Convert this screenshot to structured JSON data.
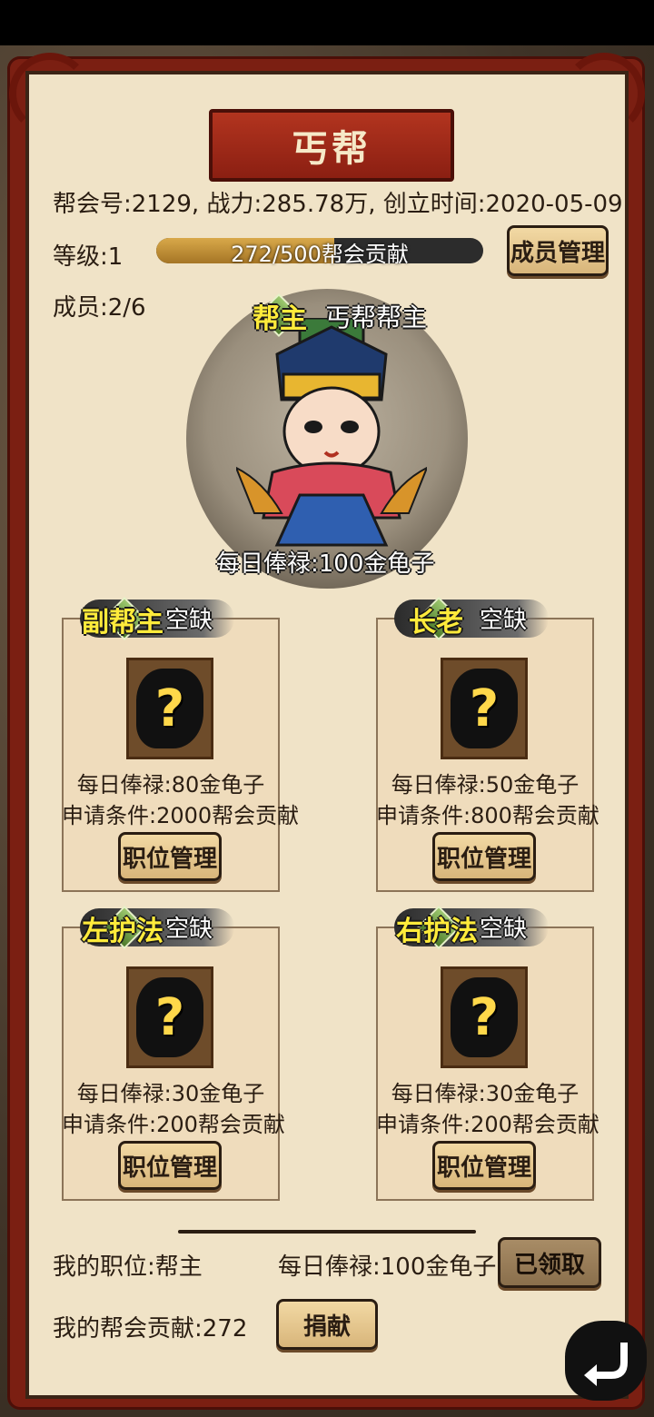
{
  "title": "丐帮",
  "info": {
    "summary": "帮会号:2129, 战力:285.78万, 创立时间:2020-05-09",
    "level": "等级:1",
    "members": "成员:2/6",
    "progress_text": "272/500帮会贡献",
    "progress_fraction": 0.544
  },
  "buttons": {
    "member_manage": "成员管理",
    "claimed": "已领取",
    "donate": "捐献"
  },
  "leader": {
    "role": "帮主",
    "name": "丐帮帮主",
    "salary": "每日俸禄:100金龟子"
  },
  "cards": [
    {
      "role": "副帮主",
      "status": "空缺",
      "salary": "每日俸禄:80金龟子",
      "requirement": "申请条件:2000帮会贡献",
      "button": "职位管理"
    },
    {
      "role": "长老",
      "status": "空缺",
      "salary": "每日俸禄:50金龟子",
      "requirement": "申请条件:800帮会贡献",
      "button": "职位管理"
    },
    {
      "role": "左护法",
      "status": "空缺",
      "salary": "每日俸禄:30金龟子",
      "requirement": "申请条件:200帮会贡献",
      "button": "职位管理"
    },
    {
      "role": "右护法",
      "status": "空缺",
      "salary": "每日俸禄:30金龟子",
      "requirement": "申请条件:200帮会贡献",
      "button": "职位管理"
    }
  ],
  "footer": {
    "my_position": "我的职位:帮主",
    "my_salary": "每日俸禄:100金龟子",
    "my_contribution": "我的帮会贡献:272"
  },
  "icons": {
    "unknown_slot": "question-mark-icon",
    "back": "return-arrow-icon",
    "role_badge": "green-diamond-icon"
  },
  "colors": {
    "frame_red": "#7b1f12",
    "panel": "#f0e3c7",
    "role_yellow": "#ffeb3b",
    "progress_gold": "#d9a94a"
  }
}
